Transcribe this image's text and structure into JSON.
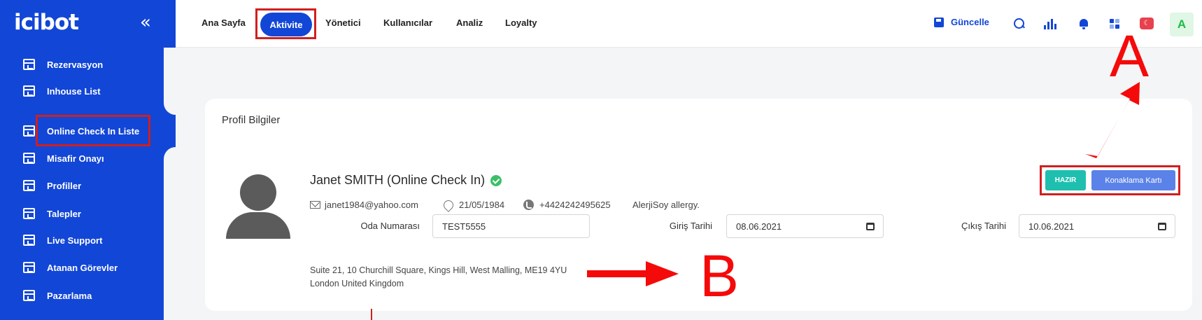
{
  "sidebar": {
    "logo": "icibot",
    "collapse_icon": "«",
    "items": [
      {
        "label": "Rezervasyon"
      },
      {
        "label": "Inhouse List"
      },
      {
        "label": "Online Check In Liste"
      },
      {
        "label": "Misafir Onayı"
      },
      {
        "label": "Profiller"
      },
      {
        "label": "Talepler"
      },
      {
        "label": "Live Support"
      },
      {
        "label": "Atanan Görevler"
      },
      {
        "label": "Pazarlama"
      }
    ]
  },
  "topbar": {
    "nav": [
      "Ana Sayfa",
      "Aktivite",
      "Yönetici",
      "Kullanıcılar",
      "Analiz",
      "Loyalty"
    ],
    "update_label": "Güncelle",
    "flag": "☾",
    "avatar_initial": "A"
  },
  "card": {
    "title": "Profil Bilgiler",
    "guest_name": "Janet SMITH (Online Check In)",
    "email": "janet1984@yahoo.com",
    "birth_date": "21/05/1984",
    "phone": "+4424242495625",
    "allergy": "AlerjiSoy allergy.",
    "room_label": "Oda Numarası",
    "room_value": "TEST5555",
    "checkin_label": "Giriş Tarihi",
    "checkin_value": "08.06.2021",
    "checkout_label": "Çıkış Tarihi",
    "checkout_value": "10.06.2021",
    "address_line1": "Suite 21, 10 Churchill Square, Kings Hill, West Malling, ME19 4YU",
    "address_line2": "London United Kingdom",
    "btn_ready": "HAZIR",
    "btn_card": "Konaklama Kartı"
  },
  "annotations": {
    "a": "A",
    "b": "B"
  },
  "colors": {
    "primary": "#1246d6",
    "teal": "#1ebfaf",
    "highlight": "#d01f1f",
    "arrow": "#f50a0a"
  }
}
